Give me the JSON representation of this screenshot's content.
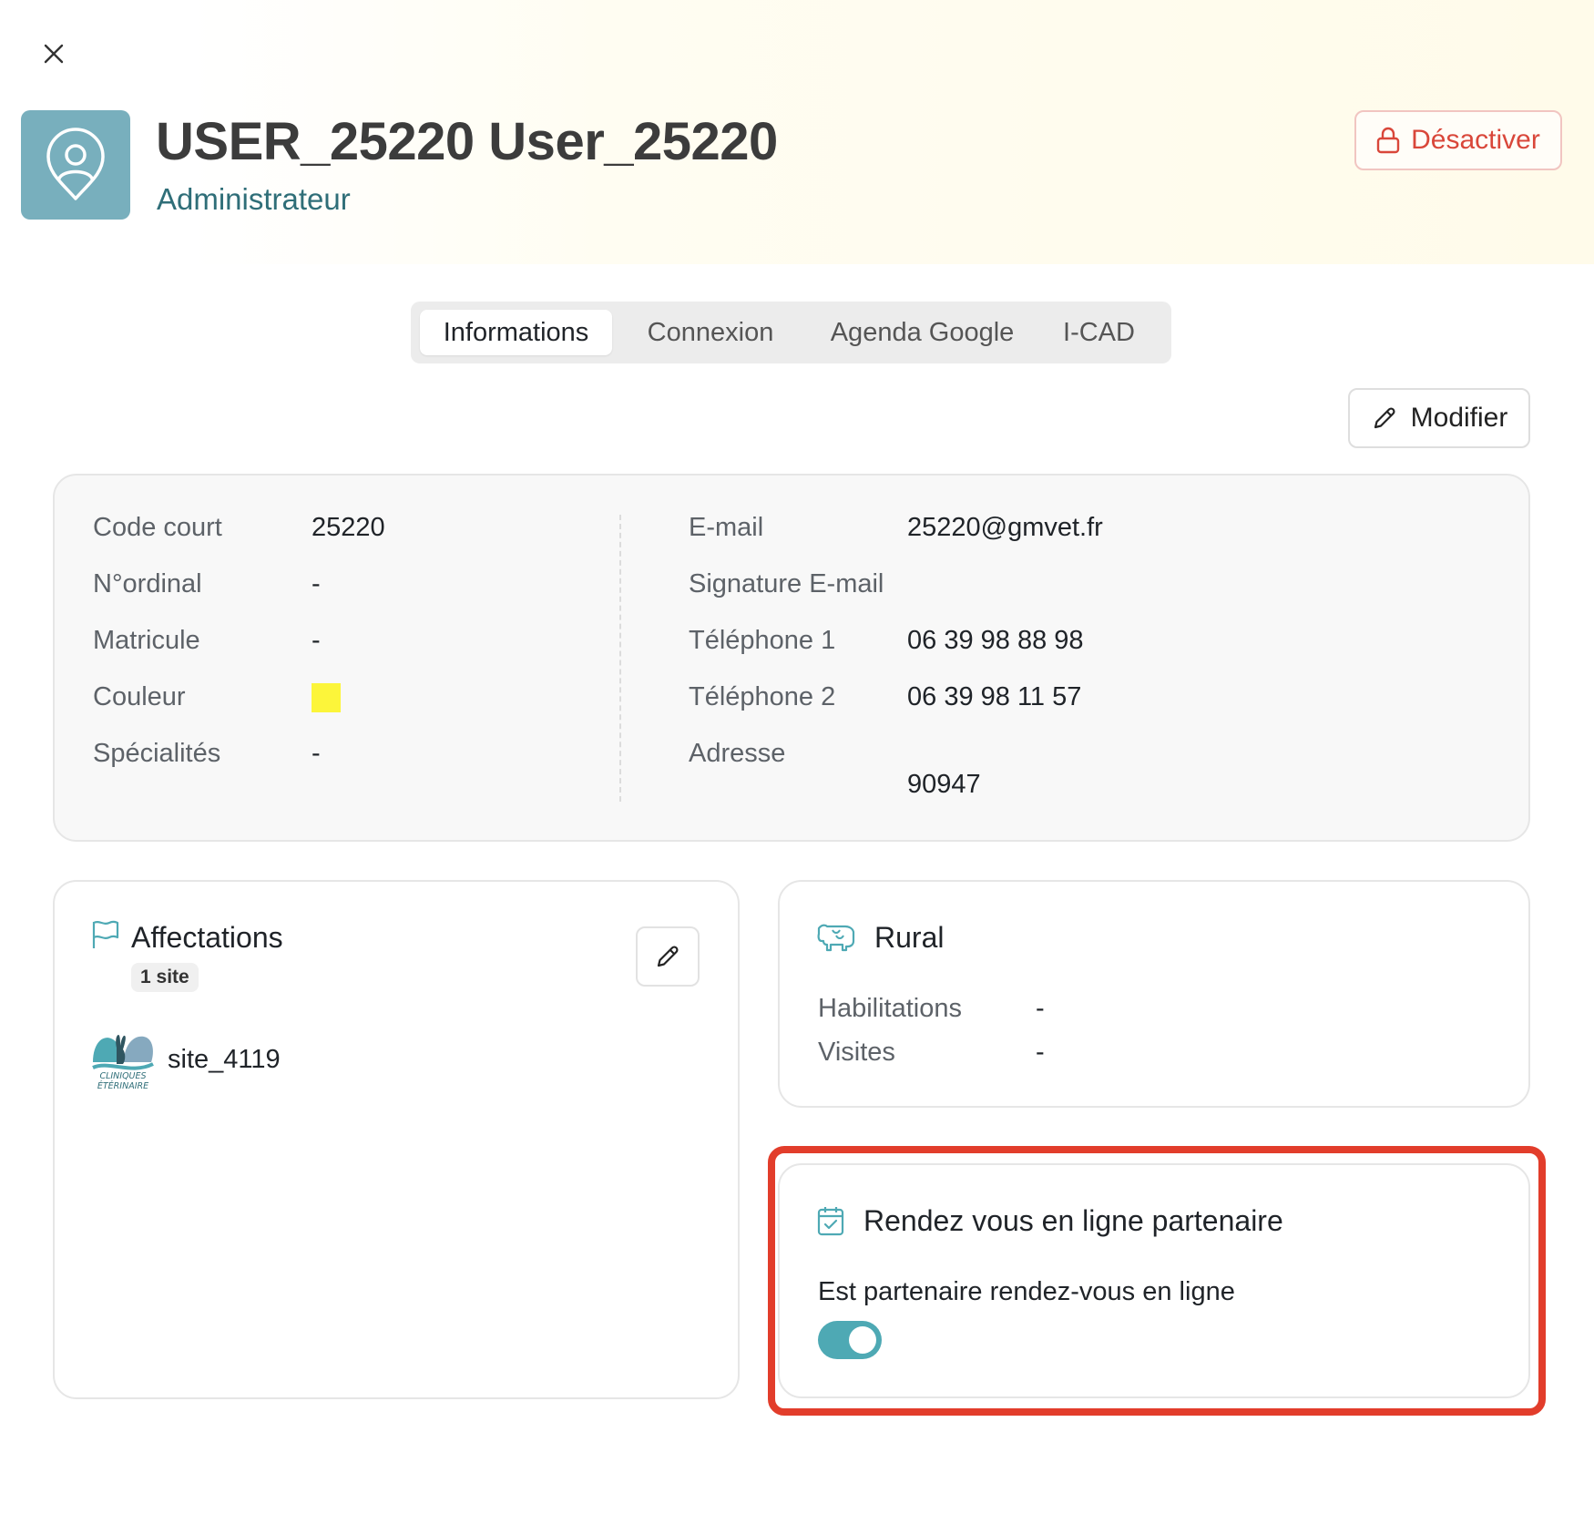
{
  "header": {
    "user_name": "USER_25220 User_25220",
    "role": "Administrateur",
    "deactivate_label": "Désactiver"
  },
  "icons": {
    "close": "close-icon",
    "avatar": "location-user-icon",
    "lock": "lock-icon",
    "pencil": "pencil-icon",
    "flag": "flag-icon",
    "cow": "cow-icon",
    "calendar": "calendar-check-icon"
  },
  "tabs": [
    {
      "label": "Informations",
      "active": true
    },
    {
      "label": "Connexion",
      "active": false
    },
    {
      "label": "Agenda Google",
      "active": false
    },
    {
      "label": "I-CAD",
      "active": false
    }
  ],
  "modify_label": "Modifier",
  "info": {
    "left": [
      {
        "label": "Code court",
        "value": "25220"
      },
      {
        "label": "N°ordinal",
        "value": "-"
      },
      {
        "label": "Matricule",
        "value": "-"
      },
      {
        "label": "Couleur",
        "value": ""
      },
      {
        "label": "Spécialités",
        "value": "-"
      }
    ],
    "right": [
      {
        "label": "E-mail",
        "value": "25220@gmvet.fr"
      },
      {
        "label": "Signature E-mail",
        "value": ""
      },
      {
        "label": "Téléphone 1",
        "value": "06 39 98 88 98"
      },
      {
        "label": "Téléphone 2",
        "value": "06 39 98 11 57"
      },
      {
        "label": "Adresse",
        "value": "90947"
      }
    ],
    "color_hex": "#fcf53a"
  },
  "affectations": {
    "title": "Affectations",
    "badge": "1 site",
    "sites": [
      {
        "name": "site_4119",
        "logo_text_1": "CLINIQUES",
        "logo_text_2": "ÉTÉRINAIRE"
      }
    ]
  },
  "rural": {
    "title": "Rural",
    "rows": [
      {
        "label": "Habilitations",
        "value": "-"
      },
      {
        "label": "Visites",
        "value": "-"
      }
    ]
  },
  "rdv": {
    "title": "Rendez vous en ligne partenaire",
    "partner_label": "Est partenaire rendez-vous en ligne",
    "partner_enabled": true
  },
  "colors": {
    "accent": "#4ea9b4",
    "danger": "#d9473a",
    "highlight": "#e23d2b",
    "avatar_bg": "#78afbd"
  }
}
